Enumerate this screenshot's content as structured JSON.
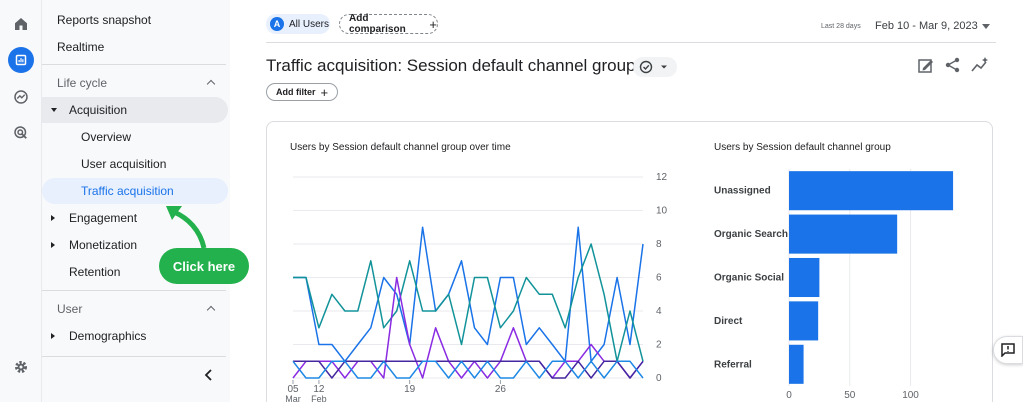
{
  "nav": {
    "reports_snapshot": "Reports snapshot",
    "realtime": "Realtime",
    "life_cycle": "Life cycle",
    "acquisition": "Acquisition",
    "overview": "Overview",
    "user_acquisition": "User acquisition",
    "traffic_acquisition": "Traffic acquisition",
    "engagement": "Engagement",
    "monetization": "Monetization",
    "retention": "Retention",
    "user": "User",
    "demographics": "Demographics"
  },
  "callout": {
    "label": "Click here",
    "color": "#22b14c"
  },
  "header": {
    "all_users_avatar": "A",
    "all_users": "All Users",
    "add_comparison": "Add comparison",
    "date_prefix": "Last 28 days",
    "date_range": "Feb 10 - Mar 9, 2023"
  },
  "page": {
    "title": "Traffic acquisition: Session default channel group",
    "add_filter": "Add filter"
  },
  "line_chart": {
    "title": "Users by Session default channel group over time",
    "y_ticks": [
      "12",
      "10",
      "8",
      "6",
      "4",
      "2",
      "0"
    ],
    "x_ticks": [
      {
        "day": "12",
        "month": "Feb"
      },
      {
        "day": "19",
        "month": ""
      },
      {
        "day": "26",
        "month": ""
      },
      {
        "day": "05",
        "month": "Mar"
      }
    ]
  },
  "bar_chart": {
    "title": "Users by Session default channel group",
    "x_ticks": [
      "0",
      "50",
      "100"
    ]
  },
  "chart_data": [
    {
      "type": "line",
      "title": "Users by Session default channel group over time",
      "ylim": [
        0,
        12
      ],
      "x": [
        "Feb 10",
        "Feb 11",
        "Feb 12",
        "Feb 13",
        "Feb 14",
        "Feb 15",
        "Feb 16",
        "Feb 17",
        "Feb 18",
        "Feb 19",
        "Feb 20",
        "Feb 21",
        "Feb 22",
        "Feb 23",
        "Feb 24",
        "Feb 25",
        "Feb 26",
        "Feb 27",
        "Feb 28",
        "Mar 1",
        "Mar 2",
        "Mar 3",
        "Mar 4",
        "Mar 5",
        "Mar 6",
        "Mar 7",
        "Mar 8",
        "Mar 9"
      ],
      "series": [
        {
          "color": "#1a73e8",
          "values": [
            6,
            6,
            2,
            2,
            1,
            2,
            3,
            6,
            5,
            2,
            9,
            4,
            5,
            7,
            3,
            2,
            6,
            6,
            2,
            3,
            2,
            1,
            9,
            1,
            2,
            6,
            2,
            8
          ]
        },
        {
          "color": "#12939a",
          "values": [
            6,
            6,
            3,
            5,
            4,
            4,
            7,
            3,
            4,
            7,
            4,
            4,
            5,
            2,
            6,
            6,
            3,
            4,
            6,
            5,
            5,
            3,
            6,
            8,
            5,
            1,
            4,
            1
          ]
        },
        {
          "color": "#8a2be2",
          "values": [
            0,
            1,
            1,
            1,
            0,
            1,
            1,
            0,
            6,
            2,
            0,
            3,
            1,
            0,
            1,
            0,
            1,
            3,
            1,
            1,
            0,
            1,
            1,
            2,
            1,
            1,
            0,
            1
          ]
        },
        {
          "color": "#4527a0",
          "values": [
            1,
            1,
            1,
            0,
            1,
            1,
            1,
            1,
            1,
            1,
            1,
            1,
            1,
            1,
            1,
            1,
            1,
            1,
            1,
            1,
            0,
            0,
            1,
            0,
            1,
            1,
            0,
            1
          ]
        },
        {
          "color": "#1e88e5",
          "values": [
            1,
            0,
            0,
            1,
            1,
            0,
            0,
            1,
            0,
            0,
            1,
            1,
            0,
            1,
            0,
            1,
            0,
            0,
            1,
            0,
            1,
            1,
            0,
            1,
            0,
            1,
            1,
            0
          ]
        }
      ]
    },
    {
      "type": "bar",
      "title": "Users by Session default channel group",
      "categories": [
        "Unassigned",
        "Organic Search",
        "Organic Social",
        "Direct",
        "Referral"
      ],
      "values": [
        135,
        89,
        25,
        24,
        12
      ],
      "xlim": [
        0,
        130
      ],
      "color": "#1a73e8"
    }
  ]
}
